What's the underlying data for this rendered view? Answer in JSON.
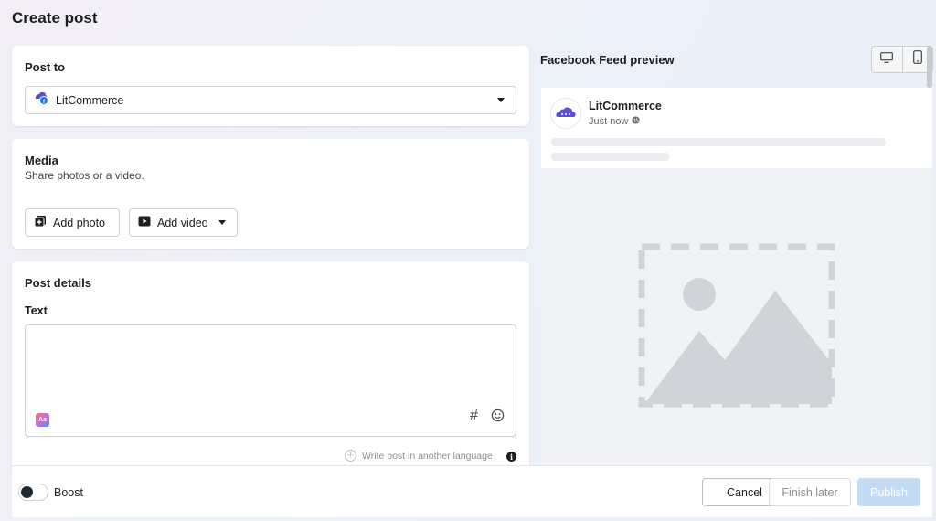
{
  "page": {
    "title": "Create post"
  },
  "post_to": {
    "title": "Post to",
    "selected_page": "LitCommerce"
  },
  "media": {
    "title": "Media",
    "subtitle": "Share photos or a video.",
    "add_photo_label": "Add photo",
    "add_video_label": "Add video"
  },
  "post_details": {
    "title": "Post details",
    "text_label": "Text",
    "text_value": "",
    "translate_label": "Write post in another language"
  },
  "preview": {
    "title": "Facebook Feed preview",
    "page_name": "LitCommerce",
    "timestamp": "Just now"
  },
  "footer": {
    "boost_label": "Boost",
    "boost_enabled": false,
    "cancel_label": "Cancel",
    "finish_later_label": "Finish later",
    "publish_label": "Publish"
  },
  "colors": {
    "primary_disabled": "#c3dbf5",
    "facebook_blue": "#1877f2",
    "brand_purple": "#5b4fd8"
  }
}
